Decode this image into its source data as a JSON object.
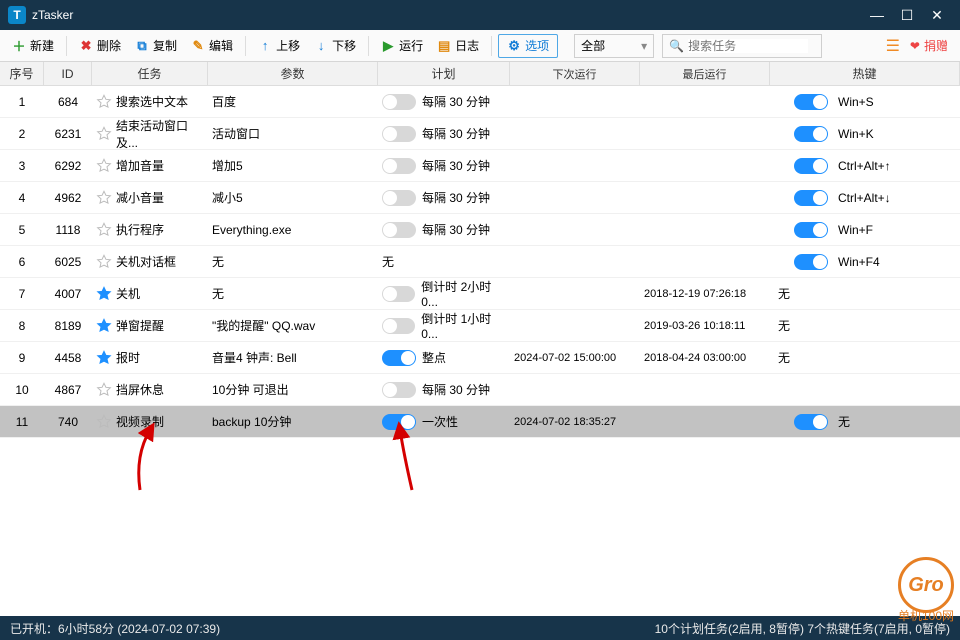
{
  "title": "zTasker",
  "toolbar": {
    "new": "新建",
    "del": "删除",
    "copy": "复制",
    "edit": "编辑",
    "up": "上移",
    "down": "下移",
    "run": "运行",
    "log": "日志",
    "opt": "选项"
  },
  "filter": {
    "value": "全部"
  },
  "search": {
    "placeholder": "搜索任务"
  },
  "donate": "捐赠",
  "columns": {
    "seq": "序号",
    "id": "ID",
    "task": "任务",
    "param": "参数",
    "plan": "计划",
    "next": "下次运行",
    "last": "最后运行",
    "hot": "热键"
  },
  "rows": [
    {
      "seq": "1",
      "id": "684",
      "fav": false,
      "task": "搜索选中文本",
      "param": "百度",
      "pon": false,
      "plan": "每隔 30 分钟",
      "next": "",
      "last": "",
      "hon": true,
      "hot": "Win+S"
    },
    {
      "seq": "2",
      "id": "6231",
      "fav": false,
      "task": "结束活动窗口及...",
      "param": "活动窗口",
      "pon": false,
      "plan": "每隔 30 分钟",
      "next": "",
      "last": "",
      "hon": true,
      "hot": "Win+K"
    },
    {
      "seq": "3",
      "id": "6292",
      "fav": false,
      "task": "增加音量",
      "param": "增加5",
      "pon": false,
      "plan": "每隔 30 分钟",
      "next": "",
      "last": "",
      "hon": true,
      "hot": "Ctrl+Alt+↑"
    },
    {
      "seq": "4",
      "id": "4962",
      "fav": false,
      "task": "减小音量",
      "param": "减小5",
      "pon": false,
      "plan": "每隔 30 分钟",
      "next": "",
      "last": "",
      "hon": true,
      "hot": "Ctrl+Alt+↓"
    },
    {
      "seq": "5",
      "id": "1118",
      "fav": false,
      "task": "执行程序",
      "param": "Everything.exe",
      "pon": false,
      "plan": "每隔 30 分钟",
      "next": "",
      "last": "",
      "hon": true,
      "hot": "Win+F"
    },
    {
      "seq": "6",
      "id": "6025",
      "fav": false,
      "task": "关机对话框",
      "param": "无",
      "pon": false,
      "plan": "无",
      "notog": true,
      "next": "",
      "last": "",
      "hon": true,
      "hot": "Win+F4"
    },
    {
      "seq": "7",
      "id": "4007",
      "fav": true,
      "task": "关机",
      "param": "无",
      "pon": false,
      "plan": "倒计时 2小时0...",
      "next": "",
      "last": "2018-12-19 07:26:18",
      "hon": false,
      "hot": "无",
      "nohottog": true
    },
    {
      "seq": "8",
      "id": "8189",
      "fav": true,
      "task": "弹窗提醒",
      "param": "\"我的提醒\" QQ.wav",
      "pon": false,
      "plan": "倒计时 1小时0...",
      "next": "",
      "last": "2019-03-26 10:18:11",
      "hon": false,
      "hot": "无",
      "nohottog": true
    },
    {
      "seq": "9",
      "id": "4458",
      "fav": true,
      "task": "报时",
      "param": "音量4 钟声: Bell",
      "pon": true,
      "plan": "整点",
      "next": "2024-07-02 15:00:00",
      "last": "2018-04-24 03:00:00",
      "hon": false,
      "hot": "无",
      "nohottog": true
    },
    {
      "seq": "10",
      "id": "4867",
      "fav": false,
      "task": "挡屏休息",
      "param": "10分钟 可退出",
      "pon": false,
      "plan": "每隔 30 分钟",
      "next": "",
      "last": "",
      "hon": false,
      "hot": "",
      "nohottog": true
    },
    {
      "seq": "11",
      "id": "740",
      "fav": false,
      "task": "视频录制",
      "param": "backup 10分钟",
      "pon": true,
      "plan": "一次性",
      "next": "2024-07-02 18:35:27",
      "last": "",
      "hon": true,
      "hot": "无",
      "sel": true
    }
  ],
  "status": {
    "left": "已开机：6小时58分 (2024-07-02 07:39)",
    "right": "10个计划任务(2启用, 8暂停)   7个热键任务(7启用, 0暂停)"
  },
  "watermark": {
    "logo": "Gro",
    "text": "单机100网"
  }
}
